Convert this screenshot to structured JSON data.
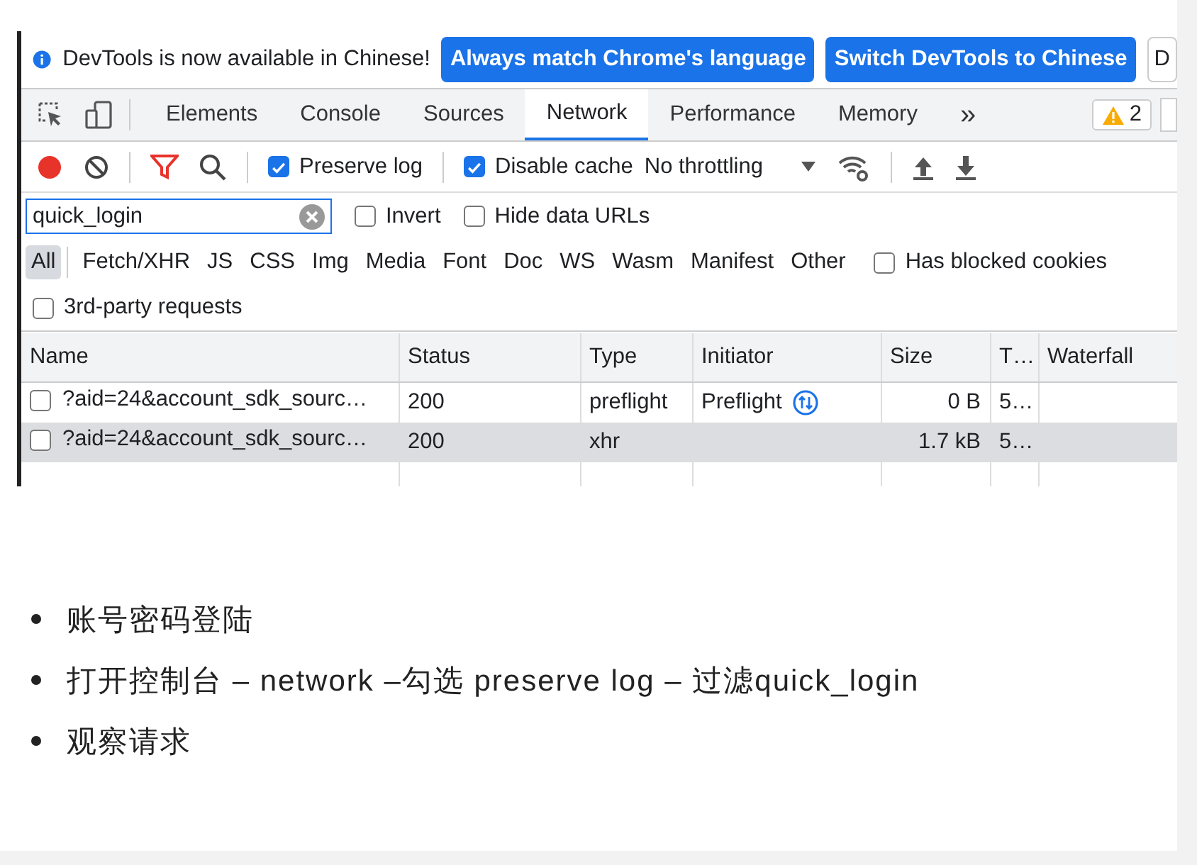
{
  "infobar": {
    "message": "DevTools is now available in Chinese!",
    "buttons": [
      "Always match Chrome's language",
      "Switch DevTools to Chinese",
      "D"
    ]
  },
  "tabs": [
    {
      "label": "Elements",
      "selected": false
    },
    {
      "label": "Console",
      "selected": false
    },
    {
      "label": "Sources",
      "selected": false
    },
    {
      "label": "Network",
      "selected": true
    },
    {
      "label": "Performance",
      "selected": false
    },
    {
      "label": "Memory",
      "selected": false
    }
  ],
  "more_tabs": "»",
  "issues_count": "2",
  "toolbar": {
    "recording": true,
    "preserve_log": {
      "label": "Preserve log",
      "checked": true
    },
    "disable_cache": {
      "label": "Disable cache",
      "checked": true
    },
    "throttling": "No throttling"
  },
  "filter": {
    "value": "quick_login",
    "invert": {
      "label": "Invert",
      "checked": false
    },
    "hide_data_urls": {
      "label": "Hide data URLs",
      "checked": false
    }
  },
  "type_filters": [
    {
      "label": "All",
      "selected": true
    },
    {
      "label": "Fetch/XHR",
      "selected": false
    },
    {
      "label": "JS",
      "selected": false
    },
    {
      "label": "CSS",
      "selected": false
    },
    {
      "label": "Img",
      "selected": false
    },
    {
      "label": "Media",
      "selected": false
    },
    {
      "label": "Font",
      "selected": false
    },
    {
      "label": "Doc",
      "selected": false
    },
    {
      "label": "WS",
      "selected": false
    },
    {
      "label": "Wasm",
      "selected": false
    },
    {
      "label": "Manifest",
      "selected": false
    },
    {
      "label": "Other",
      "selected": false
    }
  ],
  "has_blocked_cookies": {
    "label": "Has blocked cookies",
    "checked": false
  },
  "third_party": {
    "label": "3rd-party requests",
    "checked": false
  },
  "table": {
    "columns": [
      "Name",
      "Status",
      "Type",
      "Initiator",
      "Size",
      "T…",
      "Waterfall"
    ],
    "rows": [
      {
        "name": "?aid=24&account_sdk_sourc…",
        "status": "200",
        "type": "preflight",
        "initiator": "Preflight",
        "size": "0 B",
        "time": "5…",
        "selected": false
      },
      {
        "name": "?aid=24&account_sdk_sourc…",
        "status": "200",
        "type": "xhr",
        "size": "1.7 kB",
        "time": "5…",
        "selected": true
      }
    ]
  },
  "notes": [
    "账号密码登陆",
    "打开控制台 – network –勾选 preserve log – 过滤quick_login",
    "观察请求"
  ]
}
